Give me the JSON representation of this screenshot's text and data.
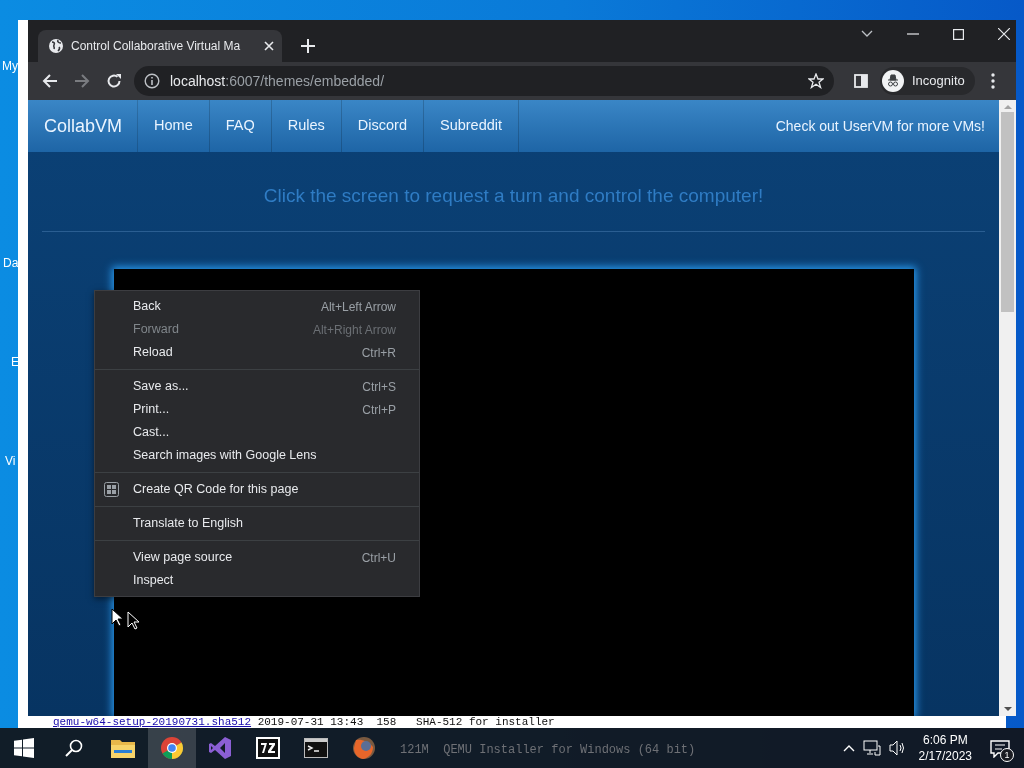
{
  "desktop_icons": [
    {
      "label": "My"
    },
    {
      "label": "Da"
    },
    {
      "label": "E"
    },
    {
      "label": "Vi"
    }
  ],
  "browser": {
    "tab_title": "Control Collaborative Virtual Ma",
    "url_host": "localhost",
    "url_rest": ":6007/themes/embedded/",
    "profile": "Incognito",
    "forward_disabled": true
  },
  "page": {
    "brand": "CollabVM",
    "nav": [
      {
        "label": "Home"
      },
      {
        "label": "FAQ"
      },
      {
        "label": "Rules"
      },
      {
        "label": "Discord"
      },
      {
        "label": "Subreddit"
      }
    ],
    "nav_right": "Check out UserVM for more VMs!",
    "prompt": "Click the screen to request a turn and control the computer!"
  },
  "context_menu": [
    {
      "kind": "item",
      "label": "Back",
      "shortcut": "Alt+Left Arrow",
      "disabled": false
    },
    {
      "kind": "item",
      "label": "Forward",
      "shortcut": "Alt+Right Arrow",
      "disabled": true
    },
    {
      "kind": "item",
      "label": "Reload",
      "shortcut": "Ctrl+R",
      "disabled": false
    },
    {
      "kind": "separator"
    },
    {
      "kind": "item",
      "label": "Save as...",
      "shortcut": "Ctrl+S",
      "disabled": false
    },
    {
      "kind": "item",
      "label": "Print...",
      "shortcut": "Ctrl+P",
      "disabled": false
    },
    {
      "kind": "item",
      "label": "Cast...",
      "disabled": false
    },
    {
      "kind": "item",
      "label": "Search images with Google Lens",
      "disabled": false
    },
    {
      "kind": "separator"
    },
    {
      "kind": "icon-item",
      "label": "Create QR Code for this page",
      "disabled": false
    },
    {
      "kind": "separator"
    },
    {
      "kind": "item",
      "label": "Translate to English",
      "disabled": false
    },
    {
      "kind": "separator"
    },
    {
      "kind": "item",
      "label": "View page source",
      "shortcut": "Ctrl+U",
      "disabled": false
    },
    {
      "kind": "item",
      "label": "Inspect",
      "disabled": false
    }
  ],
  "file_listing": [
    {
      "name": "qemu-w64-setup-20190731.sha512",
      "details": "2019-07-31 13:43  158   SHA-512 for installer"
    },
    {
      "details": "121M  QEMU Installer for Windows (64 bit)"
    }
  ],
  "taskbar": {
    "apps": [
      {
        "kind": "folder",
        "selected": false
      },
      {
        "kind": "chrome",
        "selected": true
      },
      {
        "kind": "studio",
        "selected": false
      },
      {
        "kind": "archiver",
        "selected": false
      },
      {
        "kind": "console",
        "selected": false
      },
      {
        "kind": "fox",
        "selected": false
      }
    ],
    "time": "6:06 PM",
    "date": "2/17/2023",
    "notifications": "1"
  }
}
